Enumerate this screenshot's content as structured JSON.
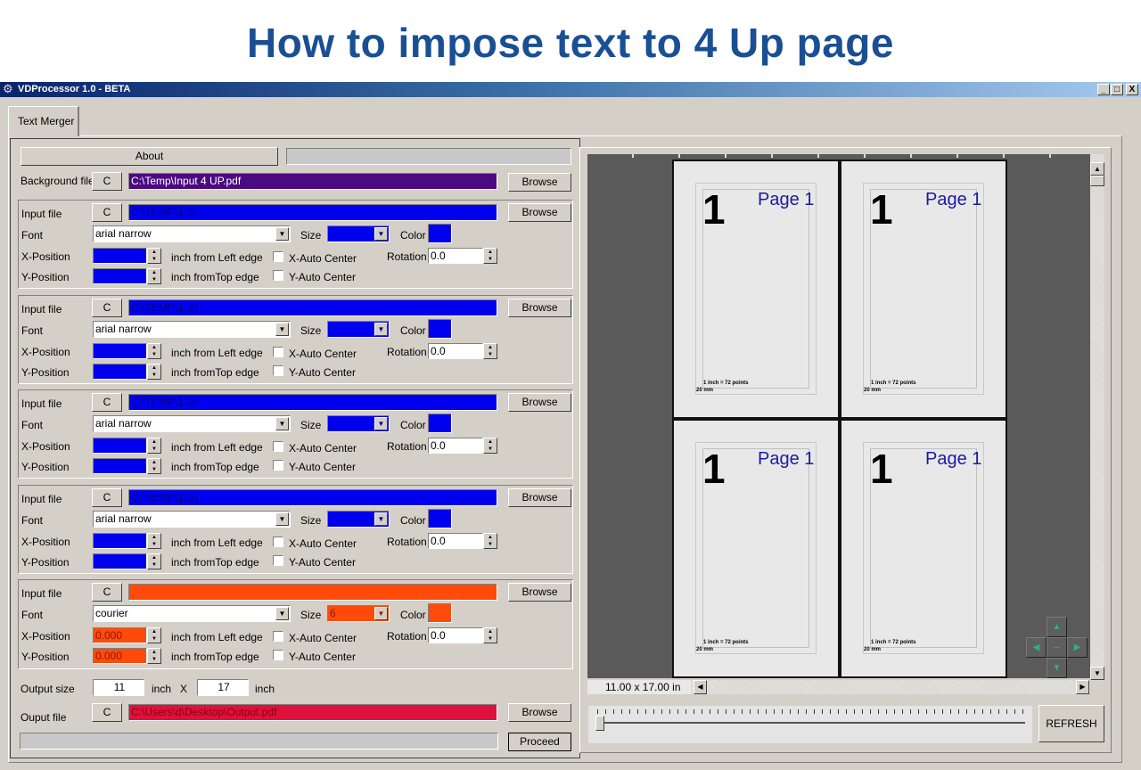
{
  "banner": {
    "title": "How to impose text to 4 Up page"
  },
  "window": {
    "title": "VDProcessor 1.0 - BETA",
    "icon": "gear-icon",
    "controls": {
      "minimize": "_",
      "maximize": "□",
      "close": "X"
    }
  },
  "tabs": [
    {
      "label": "Text Merger",
      "active": true
    }
  ],
  "left": {
    "about_label": "About",
    "background": {
      "label": "Background file",
      "clear_label": "C",
      "path": "C:\\Temp\\Input 4 UP.pdf",
      "browse_label": "Browse",
      "color": "#4b0a82"
    },
    "inputs": [
      {
        "input_label": "Input file",
        "clear_label": "C",
        "path": "C:\\TEMP\\1.txt",
        "browse_label": "Browse",
        "font_label": "Font",
        "font": "arial narrow",
        "size_label": "Size",
        "size": "",
        "color_label": "Color",
        "color": "#0000ee",
        "xpos_label": "X-Position",
        "xpos": "",
        "xunit": "inch from Left edge",
        "xauto_label": "X-Auto Center",
        "xauto": false,
        "ypos_label": "Y-Position",
        "ypos": "",
        "yunit": "inch fromTop edge",
        "yauto_label": "Y-Auto Center",
        "yauto": false,
        "rotation_label": "Rotation",
        "rotation": "0.0"
      },
      {
        "input_label": "Input file",
        "clear_label": "C",
        "path": "C:\\TEMP\\1.txt",
        "browse_label": "Browse",
        "font_label": "Font",
        "font": "arial narrow",
        "size_label": "Size",
        "size": "",
        "color_label": "Color",
        "color": "#0000ee",
        "xpos_label": "X-Position",
        "xpos": "",
        "xunit": "inch from Left edge",
        "xauto_label": "X-Auto Center",
        "xauto": false,
        "ypos_label": "Y-Position",
        "ypos": "",
        "yunit": "inch fromTop edge",
        "yauto_label": "Y-Auto Center",
        "yauto": false,
        "rotation_label": "Rotation",
        "rotation": "0.0"
      },
      {
        "input_label": "Input file",
        "clear_label": "C",
        "path": "C:\\TEMP\\1.txt",
        "browse_label": "Browse",
        "font_label": "Font",
        "font": "arial narrow",
        "size_label": "Size",
        "size": "",
        "color_label": "Color",
        "color": "#0000ee",
        "xpos_label": "X-Position",
        "xpos": "",
        "xunit": "inch from Left edge",
        "xauto_label": "X-Auto Center",
        "xauto": false,
        "ypos_label": "Y-Position",
        "ypos": "",
        "yunit": "inch fromTop edge",
        "yauto_label": "Y-Auto Center",
        "yauto": false,
        "rotation_label": "Rotation",
        "rotation": "0.0"
      },
      {
        "input_label": "Input file",
        "clear_label": "C",
        "path": "C:\\TEMP\\1.txt",
        "browse_label": "Browse",
        "font_label": "Font",
        "font": "arial narrow",
        "size_label": "Size",
        "size": "",
        "color_label": "Color",
        "color": "#0000ee",
        "xpos_label": "X-Position",
        "xpos": "",
        "xunit": "inch from Left edge",
        "xauto_label": "X-Auto Center",
        "xauto": false,
        "ypos_label": "Y-Position",
        "ypos": "",
        "yunit": "inch fromTop edge",
        "yauto_label": "Y-Auto Center",
        "yauto": false,
        "rotation_label": "Rotation",
        "rotation": "0.0"
      },
      {
        "input_label": "Input file",
        "clear_label": "C",
        "path": "",
        "browse_label": "Browse",
        "font_label": "Font",
        "font": "courier",
        "size_label": "Size",
        "size": "6",
        "color_label": "Color",
        "color": "#ff4a0a",
        "xpos_label": "X-Position",
        "xpos": "0.000",
        "xunit": "inch from Left edge",
        "xauto_label": "X-Auto Center",
        "xauto": false,
        "ypos_label": "Y-Position",
        "ypos": "0.000",
        "yunit": "inch fromTop edge",
        "yauto_label": "Y-Auto Center",
        "yauto": false,
        "rotation_label": "Rotation",
        "rotation": "0.0"
      }
    ],
    "output_size": {
      "label": "Output size",
      "width": "11",
      "unit1": "inch",
      "x": "X",
      "height": "17",
      "unit2": "inch"
    },
    "output_file": {
      "label": "Ouput file",
      "clear_label": "C",
      "path": "C:\\Users\\d\\Desktop\\Output.pdf",
      "browse_label": "Browse",
      "color": "#e0103c"
    },
    "proceed_label": "Proceed",
    "progress": 0
  },
  "preview": {
    "pages": [
      {
        "number": "1",
        "label": "Page 1",
        "note1": "1 inch = 72 points",
        "note2": "20 mm"
      },
      {
        "number": "1",
        "label": "Page 1",
        "note1": "1 inch = 72 points",
        "note2": "20 mm"
      },
      {
        "number": "1",
        "label": "Page 1",
        "note1": "1 inch = 72 points",
        "note2": "20 mm"
      },
      {
        "number": "1",
        "label": "Page 1",
        "note1": "1 inch = 72 points",
        "note2": "20 mm"
      }
    ],
    "page_size": "11.00 x 17.00 in",
    "zoom_slider": 0,
    "refresh_label": "REFRESH",
    "nav": {
      "up": "▲",
      "down": "▼",
      "left": "◀",
      "right": "▶",
      "center": "–"
    }
  }
}
